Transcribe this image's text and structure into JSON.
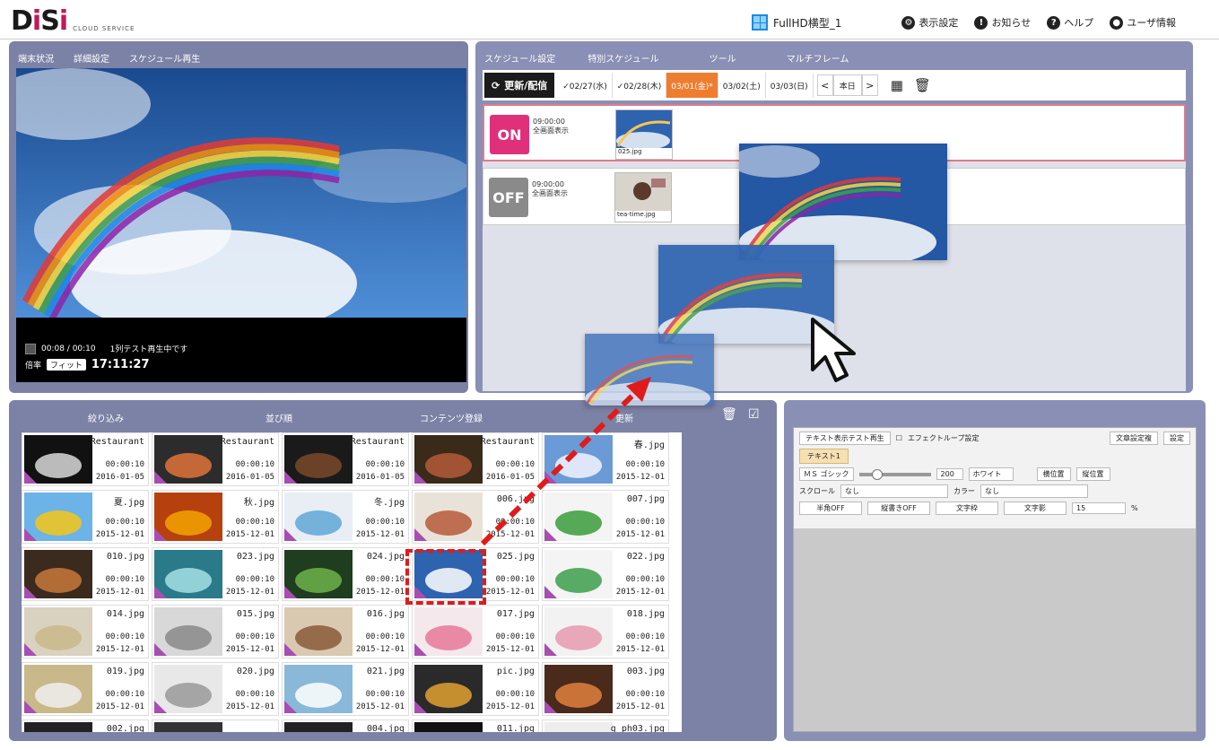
{
  "header": {
    "logo_text": "DiSi",
    "logo_sub": "CLOUD SERVICE",
    "device_name": "FullHD横型_1",
    "menu": [
      "表示設定",
      "お知らせ",
      "ヘルプ",
      "ユーザ情報"
    ]
  },
  "player_panel": {
    "tabs": [
      "端末状況",
      "詳細設定",
      "スケジュール再生"
    ],
    "time": "00:08 / 00:10",
    "status": "1列テスト再生中です",
    "scale_label": "倍率",
    "scale_value": "フィット",
    "clock": "17:11:27"
  },
  "schedule_panel": {
    "tabs": [
      "スケジュール設定",
      "特別スケジュール",
      "ツール",
      "マルチフレーム"
    ],
    "update_label": "更新/配信",
    "dates": [
      {
        "label": "✓02/27(水)",
        "active": false
      },
      {
        "label": "✓02/28(木)",
        "active": false
      },
      {
        "label": "03/01(金)*",
        "active": true
      },
      {
        "label": "03/02(土)",
        "active": false
      },
      {
        "label": "03/03(日)",
        "active": false
      }
    ],
    "today_label": "本日",
    "rows": [
      {
        "badge": "ON",
        "time": "09:00:00",
        "mode": "全画面表示",
        "file": "025.jpg"
      },
      {
        "badge": "OFF",
        "time": "09:00:00",
        "mode": "全画面表示",
        "file": "tea-time.jpg"
      }
    ]
  },
  "content_panel": {
    "tabs": [
      "絞り込み",
      "並び順",
      "コンテンツ登録",
      "更新"
    ],
    "items": [
      {
        "name": "Restaurant",
        "dur": "00:00:10",
        "date": "2016-01-05"
      },
      {
        "name": "Restaurant",
        "dur": "00:00:10",
        "date": "2016-01-05"
      },
      {
        "name": "Restaurant",
        "dur": "00:00:10",
        "date": "2016-01-05"
      },
      {
        "name": "Restaurant",
        "dur": "00:00:10",
        "date": "2016-01-05"
      },
      {
        "name": "春.jpg",
        "dur": "00:00:10",
        "date": "2015-12-01"
      },
      {
        "name": "夏.jpg",
        "dur": "00:00:10",
        "date": "2015-12-01"
      },
      {
        "name": "秋.jpg",
        "dur": "00:00:10",
        "date": "2015-12-01"
      },
      {
        "name": "冬.jpg",
        "dur": "00:00:10",
        "date": "2015-12-01"
      },
      {
        "name": "006.jpg",
        "dur": "00:00:10",
        "date": "2015-12-01"
      },
      {
        "name": "007.jpg",
        "dur": "00:00:10",
        "date": "2015-12-01"
      },
      {
        "name": "010.jpg",
        "dur": "00:00:10",
        "date": "2015-12-01"
      },
      {
        "name": "023.jpg",
        "dur": "00:00:10",
        "date": "2015-12-01"
      },
      {
        "name": "024.jpg",
        "dur": "00:00:10",
        "date": "2015-12-01"
      },
      {
        "name": "025.jpg",
        "dur": "00:00:10",
        "date": "2015-12-01"
      },
      {
        "name": "022.jpg",
        "dur": "00:00:10",
        "date": "2015-12-01"
      },
      {
        "name": "014.jpg",
        "dur": "00:00:10",
        "date": "2015-12-01"
      },
      {
        "name": "015.jpg",
        "dur": "00:00:10",
        "date": "2015-12-01"
      },
      {
        "name": "016.jpg",
        "dur": "00:00:10",
        "date": "2015-12-01"
      },
      {
        "name": "017.jpg",
        "dur": "00:00:10",
        "date": "2015-12-01"
      },
      {
        "name": "018.jpg",
        "dur": "00:00:10",
        "date": "2015-12-01"
      },
      {
        "name": "019.jpg",
        "dur": "00:00:10",
        "date": "2015-12-01"
      },
      {
        "name": "020.jpg",
        "dur": "00:00:10",
        "date": "2015-12-01"
      },
      {
        "name": "021.jpg",
        "dur": "00:00:10",
        "date": "2015-12-01"
      },
      {
        "name": "pic.jpg",
        "dur": "00:00:10",
        "date": "2015-12-01"
      },
      {
        "name": "003.jpg",
        "dur": "00:00:10",
        "date": "2015-12-01"
      },
      {
        "name": "002.jpg",
        "dur": "",
        "date": ""
      },
      {
        "name": "",
        "dur": "",
        "date": ""
      },
      {
        "name": "004.jpg",
        "dur": "",
        "date": ""
      },
      {
        "name": "011.jpg",
        "dur": "",
        "date": ""
      },
      {
        "name": "g_ph03.jpg",
        "dur": "",
        "date": ""
      }
    ]
  },
  "text_panel": {
    "test_btn": "テキスト表示テスト再生",
    "loop_label": "エフェクトループ設定",
    "copy_btn": "文章設定複",
    "set_btn": "設定",
    "tab": "テキスト1",
    "font": "ＭＳ ゴシック",
    "size": "200",
    "color": "ホワイト",
    "btn_h": "横位置",
    "btn_v": "縦位置",
    "scroll_label": "スクロール",
    "scroll_val": "なし",
    "color_label": "カラー",
    "color_val": "なし",
    "btns": [
      "半角OFF",
      "縦書きOFF",
      "文字枠",
      "文字影"
    ],
    "shadow_val": "15",
    "pct": "%"
  },
  "colors": {
    "panel": "#7c82a5",
    "accent_orange": "#ef7d2f",
    "on_badge": "#e0307a",
    "drag_arrow": "#e01b1b"
  }
}
